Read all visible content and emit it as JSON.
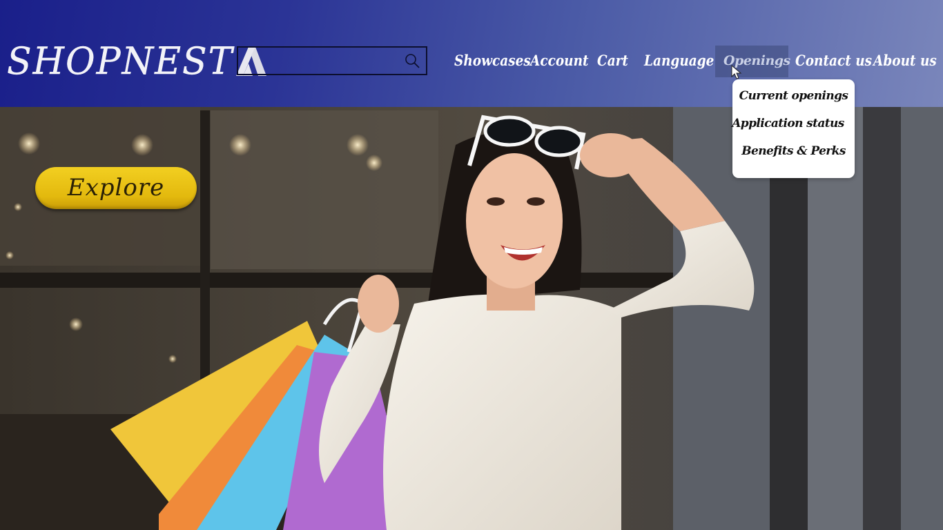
{
  "brand": {
    "logo_text": "SHOPNEST"
  },
  "search": {
    "value": "",
    "placeholder": ""
  },
  "nav": {
    "items": [
      {
        "label": "Showcases"
      },
      {
        "label": "Account"
      },
      {
        "label": "Cart"
      },
      {
        "label": "Language"
      },
      {
        "label": "Openings",
        "active": true
      },
      {
        "label": "Contact us"
      },
      {
        "label": "About us"
      }
    ]
  },
  "dropdown": {
    "items": [
      {
        "label": "Current openings"
      },
      {
        "label": "Application status"
      },
      {
        "label": "Benefits & Perks"
      }
    ]
  },
  "hero": {
    "cta_label": "Explore",
    "image_subject": "smiling woman with sunglasses holding colorful shopping bags in front of a store"
  },
  "colors": {
    "header_start": "#1a1f8a",
    "header_end": "#7a86bb",
    "cta": "#eec21a",
    "dropdown_bg": "#ffffff"
  },
  "icons": [
    "search-icon",
    "cursor-icon",
    "logo-mark-icon"
  ]
}
